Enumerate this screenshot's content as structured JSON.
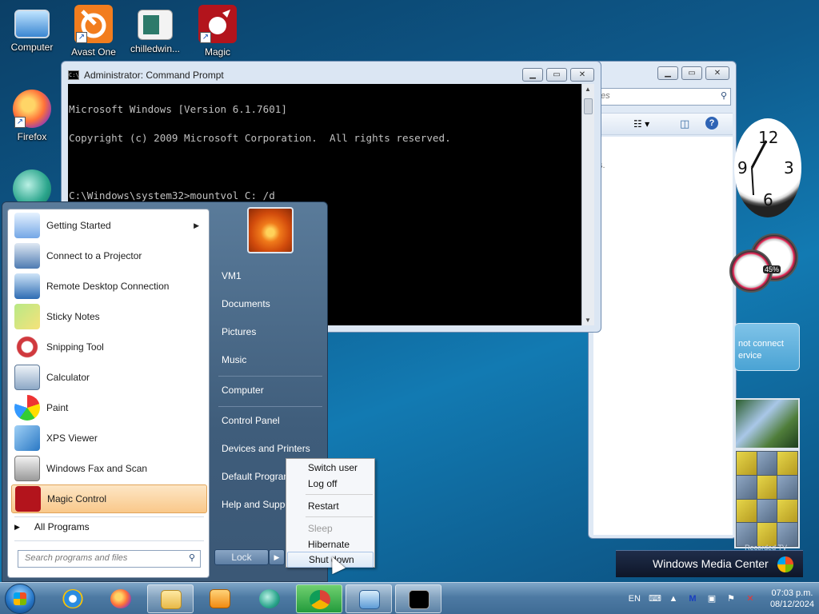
{
  "desktop": {
    "icons": [
      {
        "label": "Computer"
      },
      {
        "label": "Avast One"
      },
      {
        "label": "chilledwin..."
      },
      {
        "label": "Magic"
      },
      {
        "label": "Firefox"
      }
    ]
  },
  "explorer": {
    "search_placeholder": "es",
    "hint": "s."
  },
  "cmd": {
    "title": "Administrator: Command Prompt",
    "icon_text": "C:\\",
    "lines": [
      "Microsoft Windows [Version 6.1.7601]",
      "Copyright (c) 2009 Microsoft Corporation.  All rights reserved.",
      "",
      "C:\\Windows\\system32>mountvol C: /d",
      "",
      "C:\\Windows\\system32>"
    ]
  },
  "gadgets": {
    "clock_numbers": [
      "12",
      "3",
      "6",
      "9"
    ],
    "meter_pct": "45%",
    "weather_text": "not connect\nervice",
    "media_center": "Windows Media Center",
    "media_center_sub": "Recorded TV"
  },
  "start_menu": {
    "programs": [
      {
        "label": "Getting Started",
        "submenu": true
      },
      {
        "label": "Connect to a Projector"
      },
      {
        "label": "Remote Desktop Connection"
      },
      {
        "label": "Sticky Notes"
      },
      {
        "label": "Snipping Tool"
      },
      {
        "label": "Calculator"
      },
      {
        "label": "Paint"
      },
      {
        "label": "XPS Viewer"
      },
      {
        "label": "Windows Fax and Scan"
      },
      {
        "label": "Magic Control",
        "highlighted": true
      }
    ],
    "all_programs": "All Programs",
    "search_placeholder": "Search programs and files",
    "right_links": [
      "VM1",
      "Documents",
      "Pictures",
      "Music",
      "Computer",
      "Control Panel",
      "Devices and Printers",
      "Default Programs",
      "Help and Support"
    ],
    "lock_label": "Lock"
  },
  "power_menu": {
    "items": [
      {
        "label": "Switch user"
      },
      {
        "label": "Log off"
      },
      {
        "label": "Restart"
      },
      {
        "label": "Sleep",
        "disabled": true
      },
      {
        "label": "Hibernate"
      },
      {
        "label": "Shut down",
        "hovered": true
      }
    ]
  },
  "taskbar": {
    "language": "EN",
    "time": "07:03 p.m.",
    "date": "08/12/2024"
  },
  "colors": {
    "desktop": "#0e5a8c",
    "highlight": "#f9c88a",
    "taskbar": "#4d7aa3"
  }
}
